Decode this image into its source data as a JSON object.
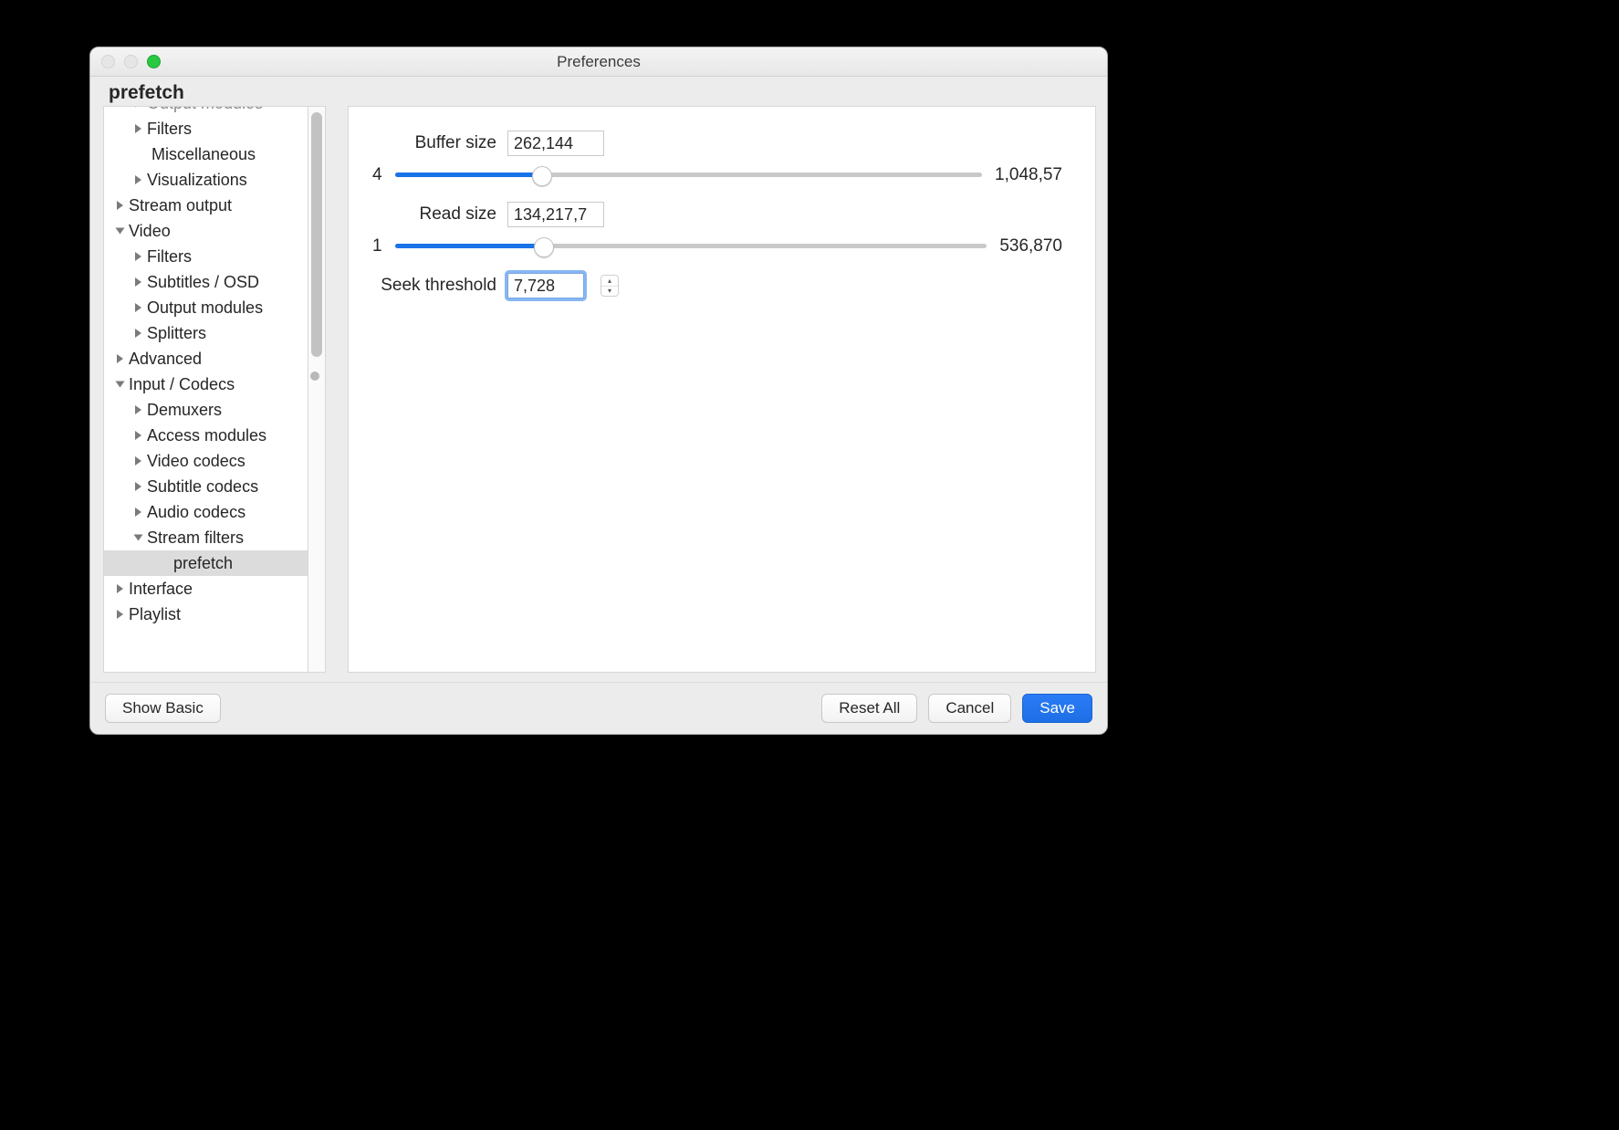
{
  "window": {
    "title": "Preferences",
    "section": "prefetch"
  },
  "sidebar": {
    "clipped_top": {
      "label": "Output modules"
    },
    "items": [
      {
        "label": "Filters",
        "level": 2,
        "disclosure": "closed"
      },
      {
        "label": "Miscellaneous",
        "level": 2,
        "disclosure": null
      },
      {
        "label": "Visualizations",
        "level": 2,
        "disclosure": "closed"
      },
      {
        "label": "Stream output",
        "level": 1,
        "disclosure": "closed"
      },
      {
        "label": "Video",
        "level": 1,
        "disclosure": "open"
      },
      {
        "label": "Filters",
        "level": 2,
        "disclosure": "closed"
      },
      {
        "label": "Subtitles / OSD",
        "level": 2,
        "disclosure": "closed"
      },
      {
        "label": "Output modules",
        "level": 2,
        "disclosure": "closed"
      },
      {
        "label": "Splitters",
        "level": 2,
        "disclosure": "closed"
      },
      {
        "label": "Advanced",
        "level": 1,
        "disclosure": "closed"
      },
      {
        "label": "Input / Codecs",
        "level": 1,
        "disclosure": "open"
      },
      {
        "label": "Demuxers",
        "level": 2,
        "disclosure": "closed"
      },
      {
        "label": "Access modules",
        "level": 2,
        "disclosure": "closed"
      },
      {
        "label": "Video codecs",
        "level": 2,
        "disclosure": "closed"
      },
      {
        "label": "Subtitle codecs",
        "level": 2,
        "disclosure": "closed"
      },
      {
        "label": "Audio codecs",
        "level": 2,
        "disclosure": "closed"
      },
      {
        "label": "Stream filters",
        "level": 2,
        "disclosure": "open"
      },
      {
        "label": "prefetch",
        "level": 3,
        "disclosure": null,
        "selected": true
      },
      {
        "label": "Interface",
        "level": 1,
        "disclosure": "closed"
      },
      {
        "label": "Playlist",
        "level": 1,
        "disclosure": "closed"
      }
    ]
  },
  "fields": {
    "buffer_size": {
      "label": "Buffer size",
      "value": "262,144",
      "slider_min_label": "4",
      "slider_max_label": "1,048,57",
      "slider_percent": 25
    },
    "read_size": {
      "label": "Read size",
      "value": "134,217,7",
      "slider_min_label": "1",
      "slider_max_label": "536,870",
      "slider_percent": 25
    },
    "seek_threshold": {
      "label": "Seek threshold",
      "value": "7,728"
    }
  },
  "footer": {
    "show_basic": "Show Basic",
    "reset_all": "Reset All",
    "cancel": "Cancel",
    "save": "Save"
  }
}
